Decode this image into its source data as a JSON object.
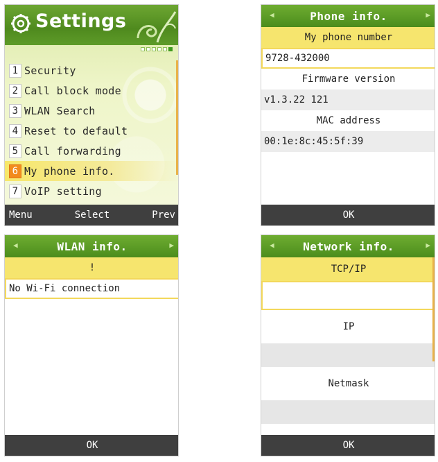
{
  "settings": {
    "title": "Settings",
    "items": [
      {
        "num": "1",
        "label": "Security"
      },
      {
        "num": "2",
        "label": "Call block mode"
      },
      {
        "num": "3",
        "label": "WLAN Search"
      },
      {
        "num": "4",
        "label": "Reset to default"
      },
      {
        "num": "5",
        "label": "Call forwarding"
      },
      {
        "num": "6",
        "label": "My phone info."
      },
      {
        "num": "7",
        "label": "VoIP setting"
      }
    ],
    "selected_index": 6,
    "softkeys": {
      "left": "Menu",
      "center": "Select",
      "right": "Prev"
    },
    "colors": {
      "header": "#4f8a1e",
      "highlight": "#f7e76a",
      "badge": "#f28b1d"
    }
  },
  "phone_info": {
    "title": "Phone info.",
    "number_label": "My phone number",
    "number_value": "9728-432000",
    "firmware_label": "Firmware version",
    "firmware_value": "v1.3.22 121",
    "mac_label": "MAC address",
    "mac_value": "00:1e:8c:45:5f:39",
    "ok_label": "OK"
  },
  "wlan_info": {
    "title": "WLAN info.",
    "alert": "!",
    "message": "No Wi-Fi connection",
    "ok_label": "OK"
  },
  "network_info": {
    "title": "Network info.",
    "tcpip_label": "TCP/IP",
    "tcpip_value": "",
    "ip_label": "IP",
    "ip_value": "",
    "netmask_label": "Netmask",
    "netmask_value": "",
    "ok_label": "OK"
  }
}
